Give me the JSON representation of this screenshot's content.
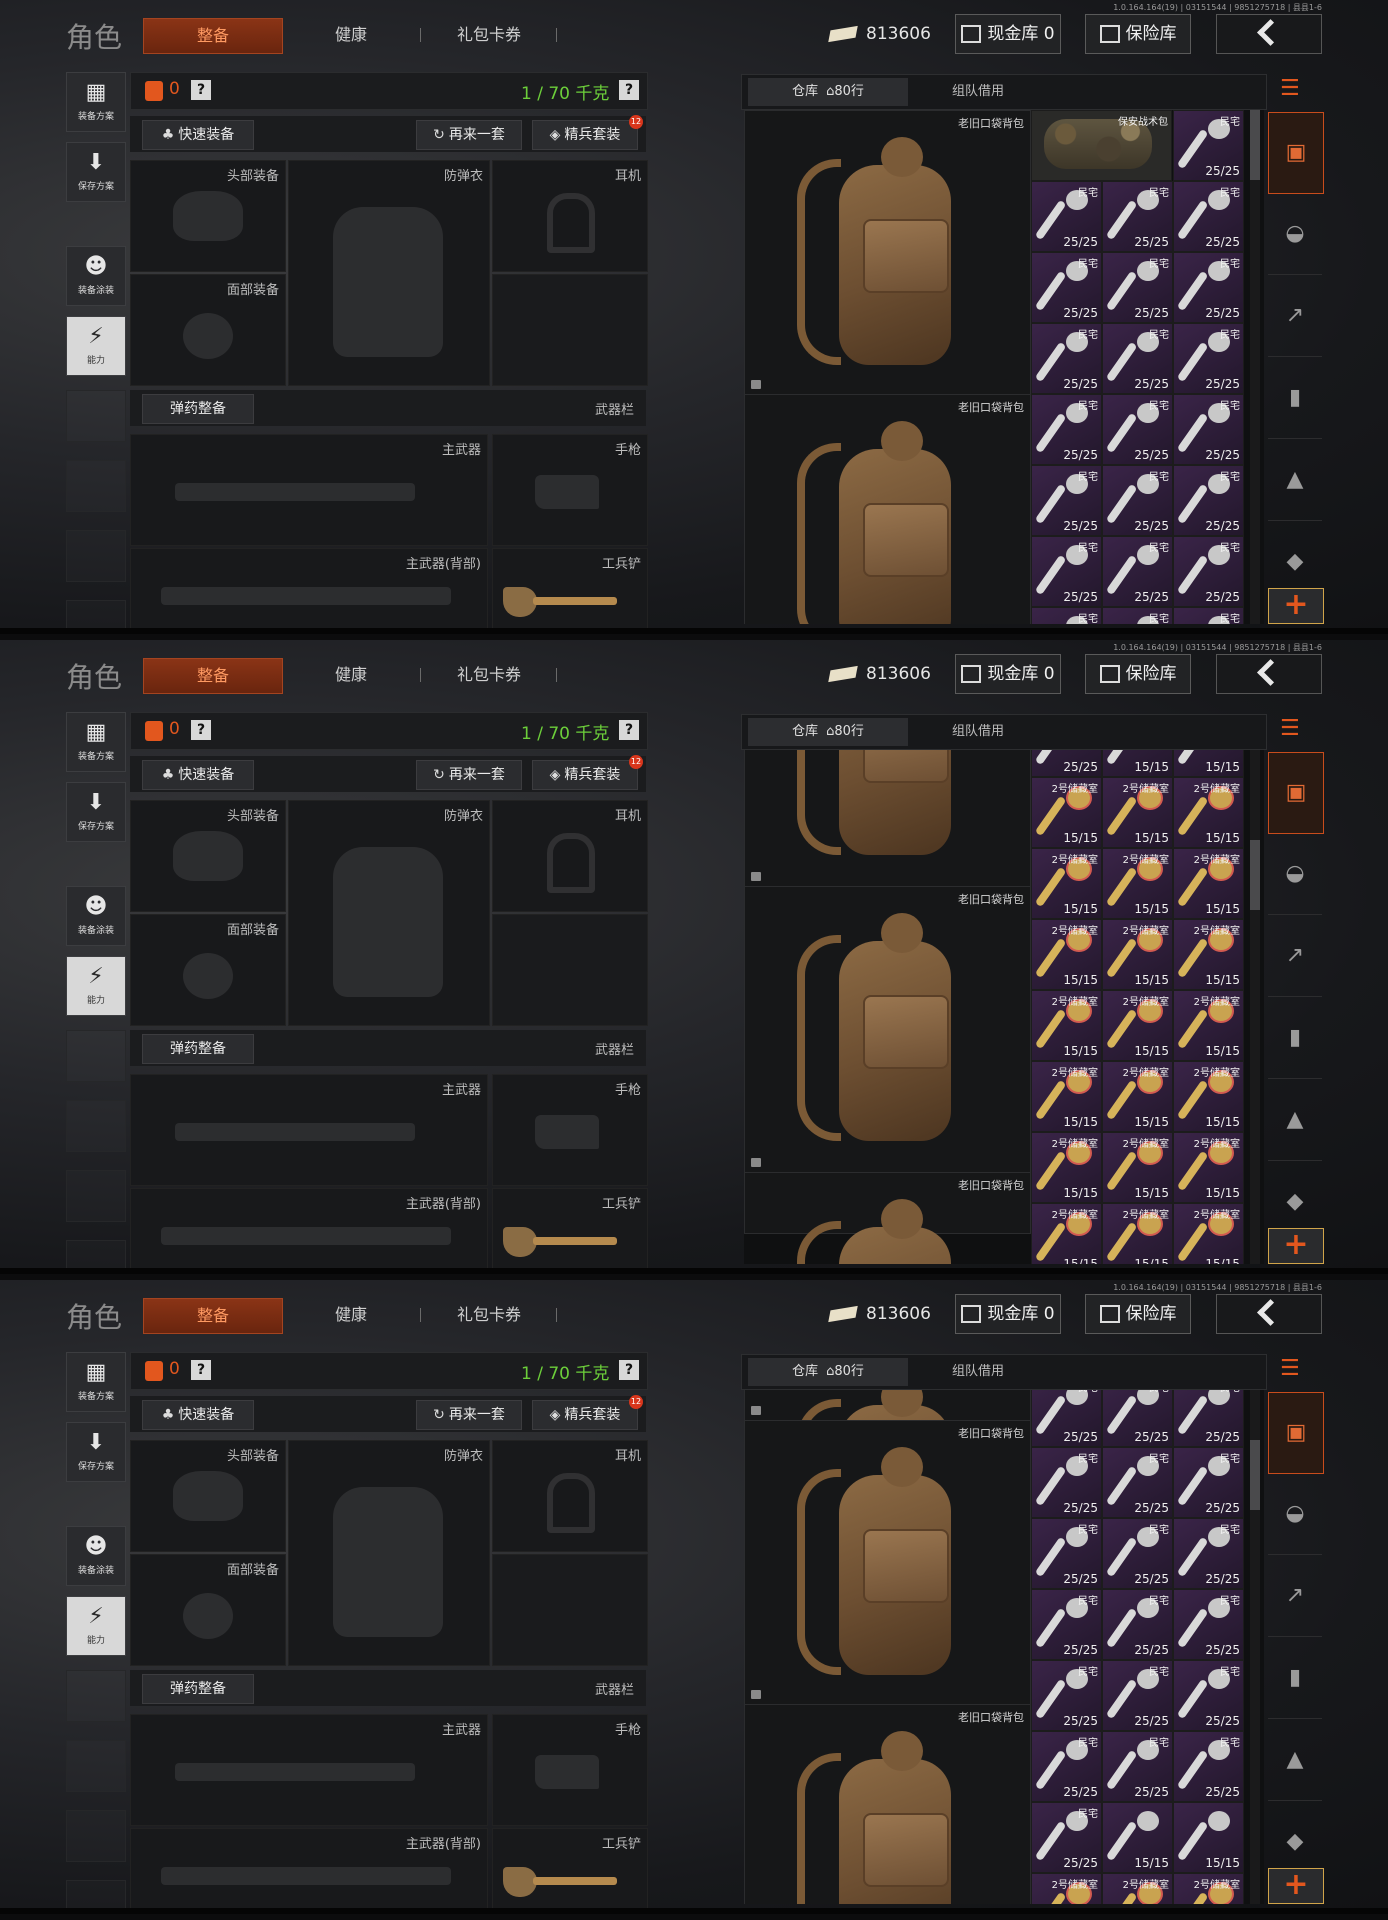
{
  "version": "1.0.164.164(19) | 03151544 | 9851275718 | 县县1-6",
  "title": "角色",
  "tabs": [
    "整备",
    "健康",
    "礼包卡券"
  ],
  "money": "813606",
  "cash_vault": "现金库 0",
  "safe_box": "保险库",
  "rail": {
    "loadout": "装备方案",
    "save": "保存方案",
    "paint": "装备涂装",
    "ability": "能力"
  },
  "equip": {
    "weight_value": "0",
    "capacity": "1 / 70 千克",
    "quick_equip": "快速装备",
    "again": "再来一套",
    "elite": "精兵套装",
    "elite_badge": "12",
    "slot_head": "头部装备",
    "slot_armor": "防弹衣",
    "slot_ear": "耳机",
    "slot_face": "面部装备",
    "ammo_btn": "弹药整备",
    "weapon_bar": "武器栏",
    "slot_primary": "主武器",
    "slot_pistol": "手枪",
    "slot_primary_back": "主武器(背部)",
    "slot_shovel": "工兵铲"
  },
  "inventory": {
    "tab_warehouse": "仓库",
    "rows": "80行",
    "tab_team": "组队借用",
    "backpack_label": "老旧口袋背包",
    "camo_label": "保安战术包",
    "house_label": "民宅",
    "house_count": "25/25",
    "storage_label": "2号储藏室",
    "storage_count": "15/15"
  }
}
